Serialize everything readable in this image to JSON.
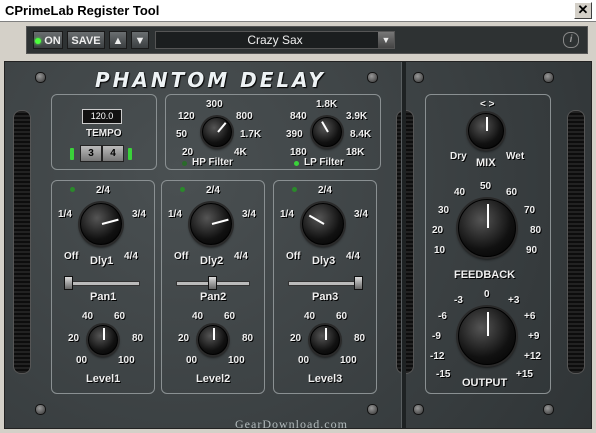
{
  "window": {
    "title": "CPrimeLab Register Tool",
    "close": "✕"
  },
  "toolbar": {
    "on_label": "ON",
    "save_label": "SAVE",
    "up_label": "▲",
    "down_label": "▼",
    "preset": "Crazy Sax",
    "dropdown": "▼",
    "info": "i"
  },
  "plugin": {
    "name": "PHANTOM DELAY",
    "watermark": "GearDownload.com"
  },
  "tempo": {
    "value": "120.0",
    "label": "TEMPO",
    "btn3": "3",
    "btn4": "4"
  },
  "hp": {
    "label": "HP Filter",
    "t300": "300",
    "t120": "120",
    "t800": "800",
    "t50": "50",
    "t1_7k": "1.7K",
    "t20": "20",
    "t4k": "4K"
  },
  "lp": {
    "label": "LP Filter",
    "t1_8k": "1.8K",
    "t840": "840",
    "t3_9k": "3.9K",
    "t390": "390",
    "t8_4k": "8.4K",
    "t180": "180",
    "t18k": "18K"
  },
  "delays": [
    {
      "label": "Dly1",
      "pan": "Pan1",
      "level": "Level1"
    },
    {
      "label": "Dly2",
      "pan": "Pan2",
      "level": "Level2"
    },
    {
      "label": "Dly3",
      "pan": "Pan3",
      "level": "Level3"
    }
  ],
  "delay_ticks": {
    "t2_4": "2/4",
    "t1_4": "1/4",
    "t3_4": "3/4",
    "off": "Off",
    "t4_4": "4/4"
  },
  "level_ticks": {
    "t40": "40",
    "t60": "60",
    "t20": "20",
    "t80": "80",
    "t00": "00",
    "t100": "100"
  },
  "mix": {
    "label": "MIX",
    "dry": "Dry",
    "wet": "Wet",
    "arrows": "< >"
  },
  "feedback": {
    "label": "FEEDBACK",
    "t40": "40",
    "t50": "50",
    "t60": "60",
    "t30": "30",
    "t70": "70",
    "t20": "20",
    "t80": "80",
    "t10": "10",
    "t90": "90"
  },
  "output": {
    "label": "OUTPUT",
    "t0": "0",
    "m3": "-3",
    "p3": "+3",
    "m6": "-6",
    "p6": "+6",
    "m9": "-9",
    "p9": "+9",
    "m12": "-12",
    "p12": "+12",
    "m15": "-15",
    "p15": "+15"
  }
}
